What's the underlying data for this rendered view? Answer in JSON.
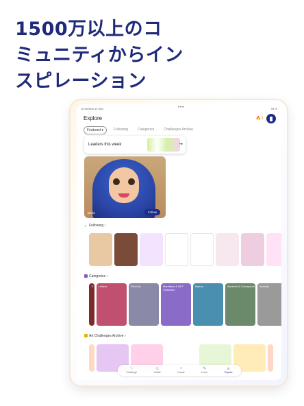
{
  "headline": {
    "line1": "1500万以上のコ",
    "line2": "ミュニティからイン",
    "line3": "スピレーション"
  },
  "status": {
    "time": "16:18",
    "date": "Mon 12 Sep",
    "dots": "•••",
    "battery": "94 %"
  },
  "app": {
    "title": "Explore",
    "streak": "1",
    "tabs": [
      {
        "label": "Featured",
        "active": true
      },
      {
        "label": "Following"
      },
      {
        "label": "Categories"
      },
      {
        "label": "Challenges Archive"
      }
    ],
    "leaders": {
      "label": "Leaders this week",
      "arrow": "→"
    },
    "featured": {
      "author": "Darla",
      "follow_label": "Follow"
    },
    "following": {
      "title": "Following",
      "chevron": "›",
      "thumbs": [
        "#e9c9a3",
        "#7b4b3a",
        "#f3e3ff",
        "#ffffff",
        "#ffffff",
        "#f7e7ee",
        "#eecde0",
        "#ffe2f6"
      ]
    },
    "categories": {
      "title": "Categories",
      "chevron": "›",
      "items": [
        {
          "label": "Tr",
          "color": "#7b2b2b"
        },
        {
          "label": "Letters",
          "color": "#c0506e"
        },
        {
          "label": "Pixel Art",
          "color": "#8a8aa8"
        },
        {
          "label": "Mandalas & NFT Collection",
          "color": "#8a6bc7"
        },
        {
          "label": "Nature",
          "color": "#4a8fb0"
        },
        {
          "label": "Abstract & Conceptual",
          "color": "#6b8a6b"
        },
        {
          "label": "Animals",
          "color": "#9a9a9a"
        }
      ]
    },
    "challenges": {
      "title": "Art Challenges Archive",
      "chevron": "›",
      "thumbs": [
        "#ffd9c2",
        "#e6c6f2",
        "#ffd0e8",
        "#ffffff",
        "#e8f6d8",
        "#ffecb8",
        "#ffd6c6"
      ]
    },
    "nav": [
      {
        "label": "Challenge",
        "icon": "♡"
      },
      {
        "label": "Collab",
        "icon": "☺"
      },
      {
        "label": "Create",
        "icon": "+"
      },
      {
        "label": "Learn",
        "icon": "✎"
      },
      {
        "label": "Explore",
        "icon": "⌕",
        "active": true
      }
    ]
  }
}
